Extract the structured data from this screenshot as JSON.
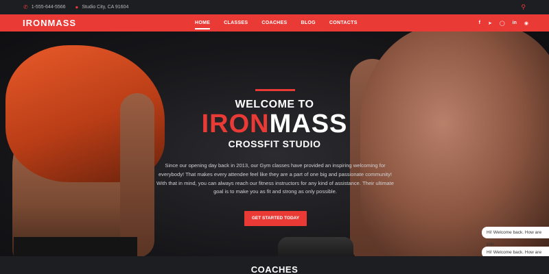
{
  "topbar": {
    "phone": "1-555-644-5566",
    "location": "Studio City, CA 91604"
  },
  "navbar": {
    "logo": "IRONMASS",
    "menu": [
      "HOME",
      "CLASSES",
      "COACHES",
      "BLOG",
      "CONTACTS"
    ],
    "active_index": 0,
    "social_icons": [
      "facebook-icon",
      "twitter-icon",
      "instagram-icon",
      "linkedin-icon",
      "pinterest-icon"
    ]
  },
  "hero": {
    "welcome": "WELCOME TO",
    "brand_red": "IRON",
    "brand_white": "MASS",
    "subtitle": "CROSSFIT STUDIO",
    "description": "Since our opening day back in 2013, our Gym classes have provided an inspiring welcoming for everybody! That makes every attendee feel like they are a part of one big and passionate community! With that in mind, you can always reach our fitness instructors for any kind of assistance. Their ultimate goal is to make you as fit and strong as only possible.",
    "cta": "GET STARTED TODAY"
  },
  "chat": {
    "message_1": "Hi! Welcome back. How are you",
    "message_2": "Hi! Welcome back. How are you"
  },
  "section": {
    "title": "COACHES"
  },
  "colors": {
    "accent": "#ea3a36",
    "dark": "#1d1e22"
  }
}
